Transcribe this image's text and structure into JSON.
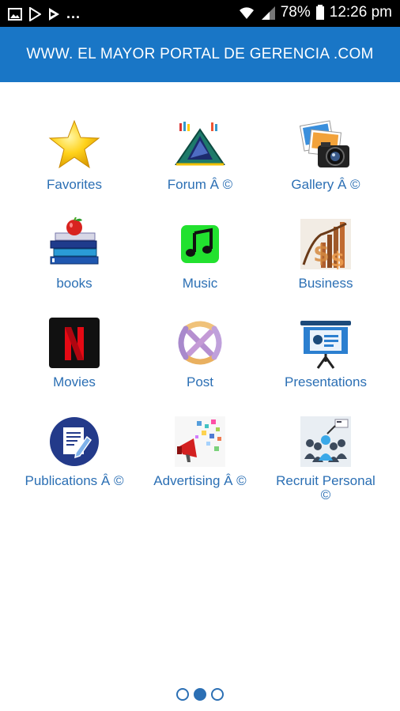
{
  "status_bar": {
    "more": "...",
    "battery": "78%",
    "time": "12:26 pm"
  },
  "header": {
    "title": "WWW. EL MAYOR PORTAL DE GERENCIA .COM"
  },
  "grid": {
    "items": [
      {
        "label": "Favorites",
        "icon": "star-icon"
      },
      {
        "label": "Forum Â ©",
        "icon": "forum-mountain-icon"
      },
      {
        "label": "Gallery Â ©",
        "icon": "camera-photos-icon"
      },
      {
        "label": "books",
        "icon": "books-apple-icon"
      },
      {
        "label": "Music",
        "icon": "music-note-icon"
      },
      {
        "label": "Business",
        "icon": "business-chart-icon"
      },
      {
        "label": "Movies",
        "icon": "netflix-icon"
      },
      {
        "label": "Post",
        "icon": "post-knot-icon"
      },
      {
        "label": "Presentations",
        "icon": "presentation-board-icon"
      },
      {
        "label": "Publications Â ©",
        "icon": "publication-edit-icon"
      },
      {
        "label": "Advertising Â ©",
        "icon": "megaphone-icon"
      },
      {
        "label": "Recruit Personal\n©",
        "icon": "recruit-people-icon"
      }
    ]
  },
  "pager": {
    "pages": 3,
    "active": 2
  },
  "colors": {
    "header": "#1976c6",
    "label": "#2b6fb4",
    "status_bar": "#000000"
  }
}
